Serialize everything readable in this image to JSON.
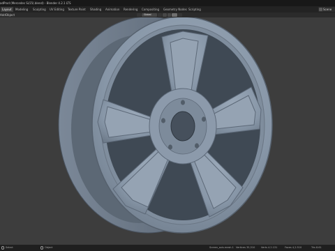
{
  "window": {
    "title": "adProd (Mercedes SL55(.blend) - Blender 4.2.1 LTS"
  },
  "workspace_tabs": [
    {
      "label": "Layout",
      "active": true
    },
    {
      "label": "Modeling",
      "active": false
    },
    {
      "label": "Sculpting",
      "active": false
    },
    {
      "label": "UV Editing",
      "active": false
    },
    {
      "label": "Texture Paint",
      "active": false
    },
    {
      "label": "Shading",
      "active": false
    },
    {
      "label": "Animation",
      "active": false
    },
    {
      "label": "Rendering",
      "active": false
    },
    {
      "label": "Compositing",
      "active": false
    },
    {
      "label": "Geometry Nodes",
      "active": false
    },
    {
      "label": "Scripting",
      "active": false
    }
  ],
  "scene": {
    "name": "Scene"
  },
  "header": {
    "menu_add": "Add",
    "menu_object": "Object",
    "orientation": "Global"
  },
  "statusbar": {
    "left_action": "Select",
    "mid_action": "Object",
    "stats": [
      "Screen_axis.mesh.1",
      "Vertices 35,510",
      "Verts 4.2.131",
      "Faces 4,2.510",
      "Tris 8.61"
    ]
  },
  "colors": {
    "wheel_face": "#8a98a8",
    "wheel_dark": "#3f4954",
    "background": "#3d3d3d"
  }
}
